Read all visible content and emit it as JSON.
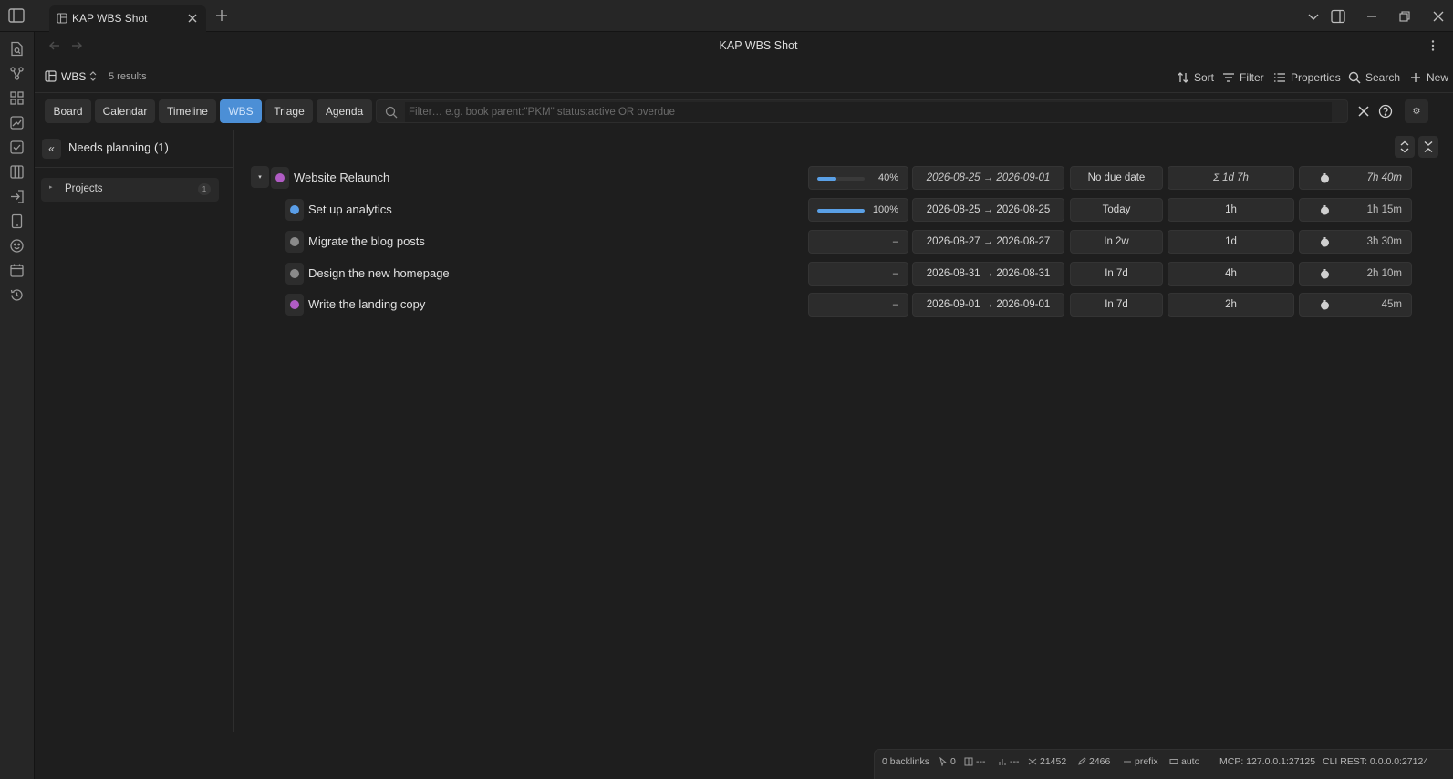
{
  "window": {
    "tab_title": "KAP WBS Shot",
    "view_title": "KAP WBS Shot"
  },
  "toolbar": {
    "base_name": "WBS",
    "result_count": "5 results",
    "sort_label": "Sort",
    "filter_label": "Filter",
    "properties_label": "Properties",
    "search_label": "Search",
    "new_label": "New"
  },
  "view_tabs": [
    {
      "label": "Board",
      "active": false
    },
    {
      "label": "Calendar",
      "active": false
    },
    {
      "label": "Timeline",
      "active": false
    },
    {
      "label": "WBS",
      "active": true
    },
    {
      "label": "Triage",
      "active": false
    },
    {
      "label": "Agenda",
      "active": false
    }
  ],
  "filter": {
    "placeholder": "Filter… e.g. book parent:\"PKM\" status:active OR overdue",
    "settings_glyph": "⚙"
  },
  "left_panel": {
    "collapse_glyph": "«",
    "title": "Needs planning (1)",
    "groups": [
      {
        "label": "Projects",
        "count": "1"
      }
    ]
  },
  "tasks": [
    {
      "title": "Website Relaunch",
      "status_color": "#b05cc4",
      "progress_value": 0.4,
      "progress_text": "40%",
      "dates": "2026-08-25 → 2026-09-01",
      "due": "No due date",
      "estimate": "Σ  1d  7h",
      "tracked": "7h  40m",
      "is_parent": true,
      "rollup": true
    },
    {
      "title": "Set up analytics",
      "status_color": "#5a9ee8",
      "progress_value": 1.0,
      "progress_text": "100%",
      "dates": "2026-08-25 → 2026-08-25",
      "due": "Today",
      "estimate": "1h",
      "tracked": "1h  15m",
      "is_parent": false,
      "rollup": false
    },
    {
      "title": "Migrate the blog posts",
      "status_color": "#8a8a8a",
      "progress_value": null,
      "progress_text": "–",
      "dates": "2026-08-27 → 2026-08-27",
      "due": "In 2w",
      "estimate": "1d",
      "tracked": "3h  30m",
      "is_parent": false,
      "rollup": false
    },
    {
      "title": "Design the new homepage",
      "status_color": "#8a8a8a",
      "progress_value": null,
      "progress_text": "–",
      "dates": "2026-08-31 → 2026-08-31",
      "due": "In 7d",
      "estimate": "4h",
      "tracked": "2h  10m",
      "is_parent": false,
      "rollup": false
    },
    {
      "title": "Write the landing copy",
      "status_color": "#b05cc4",
      "progress_value": null,
      "progress_text": "–",
      "dates": "2026-09-01 → 2026-09-01",
      "due": "In 7d",
      "estimate": "2h",
      "tracked": "45m",
      "is_parent": false,
      "rollup": false
    }
  ],
  "statusbar": {
    "backlinks": "0 backlinks",
    "edits": "0",
    "sel": "---",
    "chart": "---",
    "words": "21452",
    "chars": "2466",
    "prefix": "prefix",
    "mode": "auto",
    "mcp": "MCP: 127.0.0.1:27125",
    "cli": "CLI REST: 0.0.0.0:27124"
  },
  "colors": {
    "accent": "#4c8fd6",
    "progress_fill": "#5aa0e6"
  }
}
